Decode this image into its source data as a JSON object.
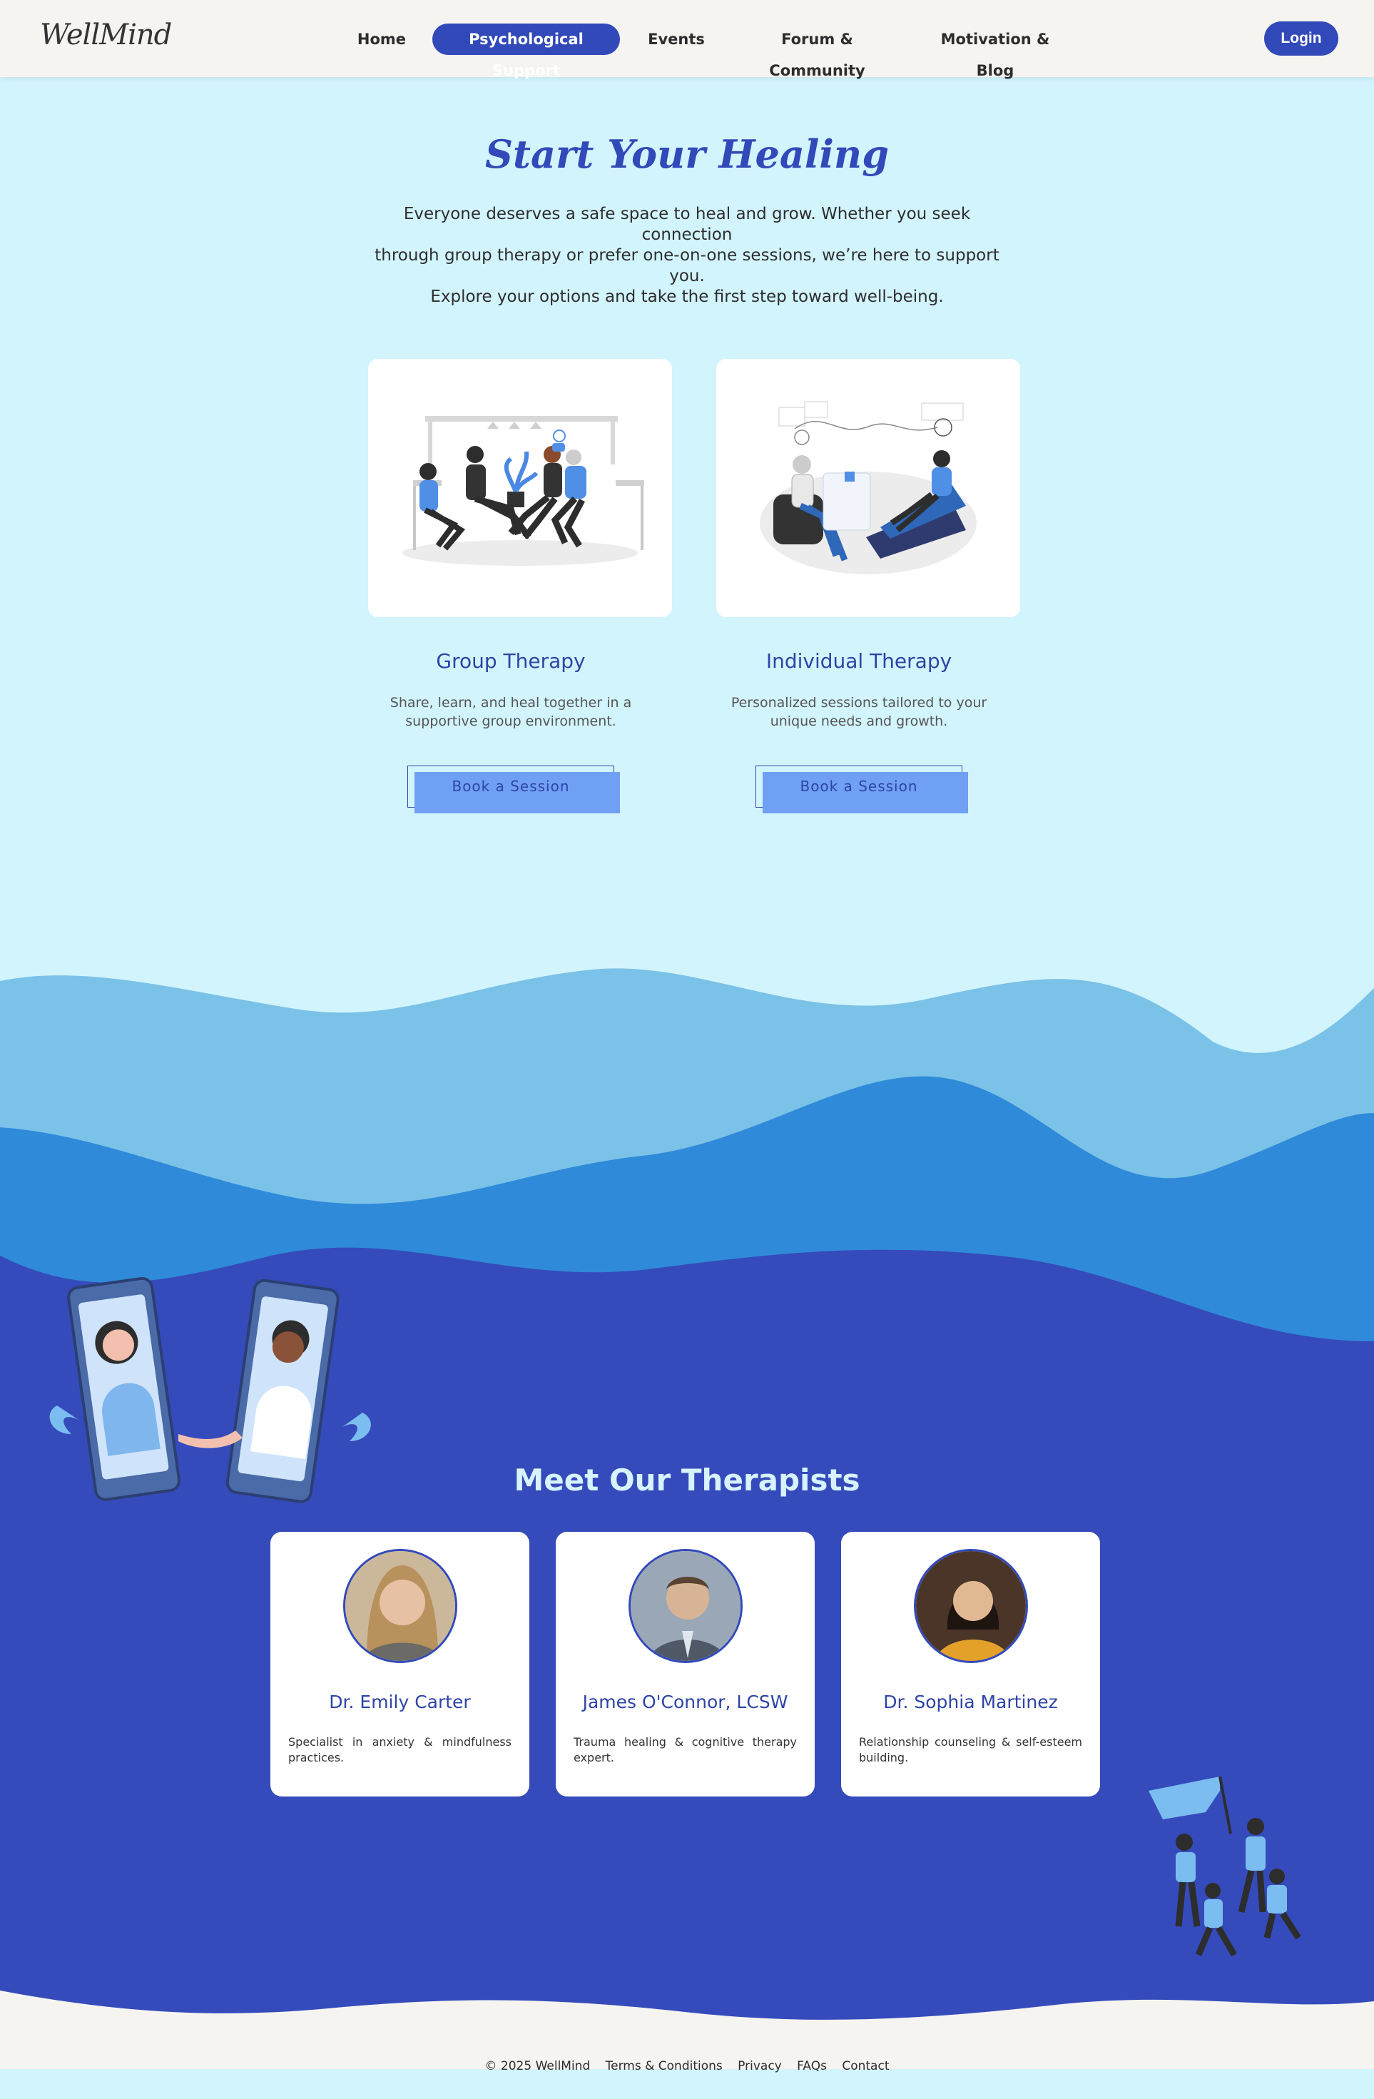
{
  "brand": "WellMind",
  "nav": {
    "items": [
      "Home",
      "Psychological Support",
      "Events",
      "Forum & Community",
      "Motivation & Blog"
    ],
    "active": "Psychological Support",
    "login": "Login"
  },
  "hero": {
    "title": "Start Your Healing",
    "text_lines": [
      "Everyone deserves a safe space to heal and grow. Whether you seek connection",
      "through group therapy or prefer one-on-one sessions, we’re here to support you.",
      "Explore your options and take the first step toward well-being."
    ]
  },
  "therapies": [
    {
      "title": "Group Therapy",
      "desc_lines": [
        "Share, learn, and heal together in a",
        "supportive group environment."
      ],
      "button": "Book a Session"
    },
    {
      "title": "Individual Therapy",
      "desc_lines": [
        "Personalized sessions tailored to your",
        "unique needs and growth."
      ],
      "button": "Book a Session"
    }
  ],
  "therapists_section": {
    "title": "Meet Our Therapists",
    "therapists": [
      {
        "name": "Dr. Emily Carter",
        "desc": "Specialist in anxiety & mindfulness practices."
      },
      {
        "name": "James O'Connor, LCSW",
        "desc": "Trauma healing & cognitive therapy expert."
      },
      {
        "name": "Dr. Sophia Martinez",
        "desc": "Relationship counseling & self-esteem building."
      }
    ]
  },
  "footer": {
    "copyright": "© 2025 WellMind",
    "links": [
      "Terms & Conditions",
      "Privacy",
      "FAQs",
      "Contact"
    ]
  },
  "colors": {
    "primary": "#3249b9",
    "hero_bg": "#d2f4fd",
    "wave_light": "#7bc2e8",
    "wave_mid": "#2f8ad9",
    "wave_dark": "#354bbb",
    "button": "#6fa0f4",
    "footer_bg": "#f5f4f1"
  }
}
